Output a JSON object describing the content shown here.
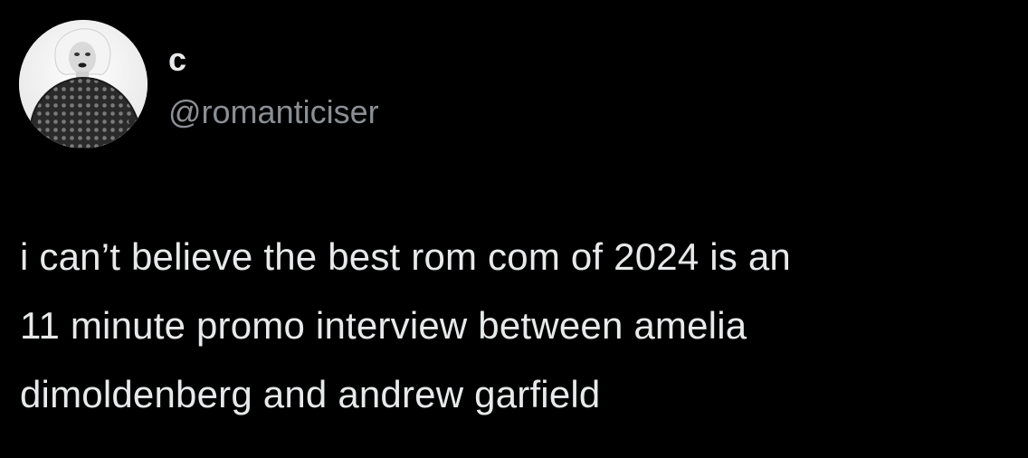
{
  "tweet": {
    "author": {
      "display_name": "c",
      "handle": "@romanticiser",
      "avatar_icon": "profile-photo-avatar"
    },
    "text_lines": [
      "i can’t believe the best rom com of 2024 is an",
      "11 minute promo interview between amelia",
      "dimoldenberg and andrew garfield"
    ]
  },
  "colors": {
    "background": "#000000",
    "primary_text": "#e7e9ea",
    "secondary_text": "#8b8f94"
  }
}
